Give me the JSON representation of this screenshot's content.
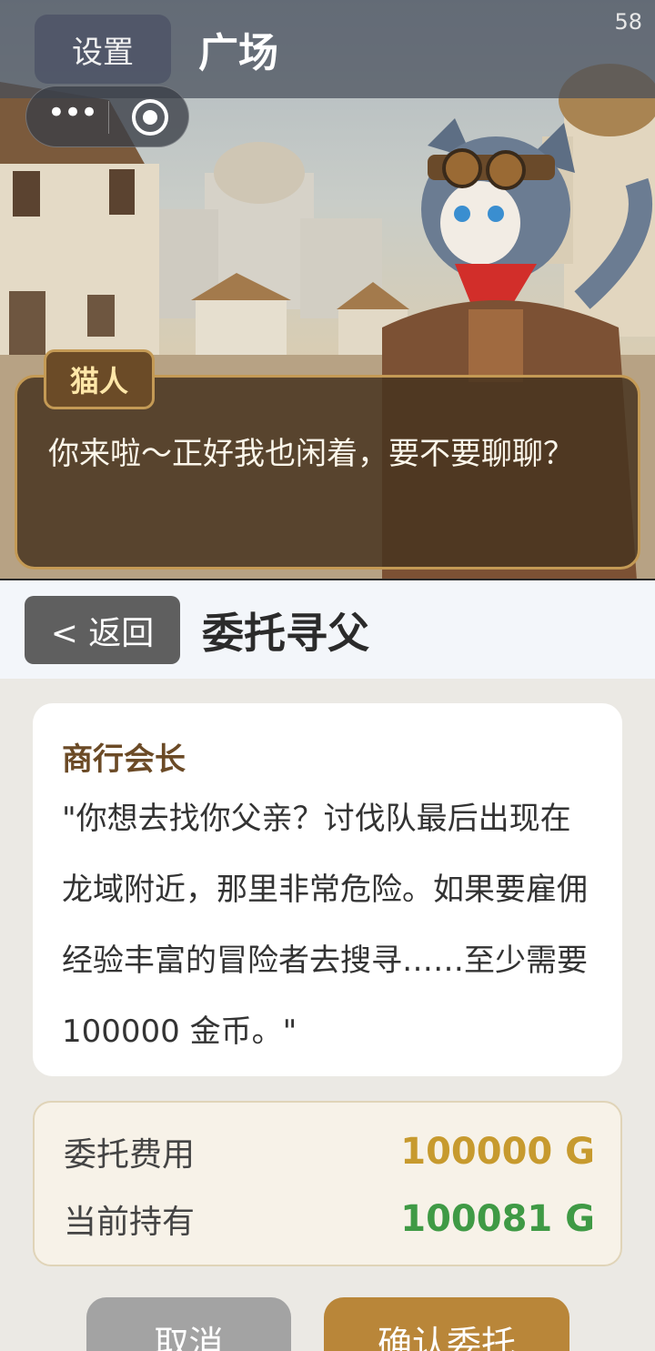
{
  "hud": {
    "fps": "58",
    "settings_label": "设置",
    "scene_title": "广场"
  },
  "capsule": {
    "more_label": "•••"
  },
  "dialog": {
    "speaker": "猫人",
    "line": "你来啦～正好我也闲着，要不要聊聊？"
  },
  "panel": {
    "back_label": "< 返回",
    "title": "委托寻父",
    "quote_speaker": "商行会长",
    "quote_text": "\"你想去找你父亲？讨伐队最后出现在龙域附近，那里非常危险。如果要雇佣经验丰富的冒险者去搜寻……至少需要 100000 金币。\"",
    "cost_label": "委托费用",
    "cost_value": "100000 G",
    "held_label": "当前持有",
    "held_value": "100081 G",
    "cancel_label": "取消",
    "confirm_label": "确认委托"
  },
  "colors": {
    "cost_value": "#c79a2e",
    "held_value": "#3f9a45",
    "confirm_button": "#b98639",
    "cancel_button": "#a3a3a3"
  }
}
